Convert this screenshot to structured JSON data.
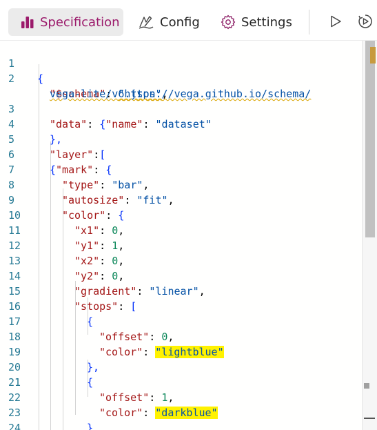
{
  "toolbar": {
    "tabs": [
      {
        "label": "Specification",
        "icon": "bar-chart-icon",
        "active": true
      },
      {
        "label": "Config",
        "icon": "pen-signature-icon"
      },
      {
        "label": "Settings",
        "icon": "gear-icon"
      }
    ],
    "run_icon": "play-icon",
    "autorun_icon": "auto-run-icon"
  },
  "colors": {
    "active_tab_accent": "#9b1a6b",
    "line_number": "#237893",
    "key": "#a31515",
    "string": "#0451a5",
    "number": "#098658",
    "highlight": "#fff200"
  },
  "editor": {
    "line_numbers": [
      "1",
      "2",
      "",
      "3",
      "4",
      "5",
      "6",
      "7",
      "8",
      "9",
      "10",
      "11",
      "12",
      "13",
      "14",
      "15",
      "16",
      "17",
      "18",
      "19",
      "20",
      "21",
      "22",
      "23",
      "24"
    ],
    "tokens": {
      "l1_open": "{",
      "schema_key": "\"$schema\"",
      "colon_space": ": ",
      "colon": ":",
      "schema_url_1": "\"https://vega.github.io/schema/",
      "schema_url_2": "vega-lite/v6.json\"",
      "comma": ",",
      "data_key": "\"data\"",
      "open_brace": "{",
      "name_key": "\"name\"",
      "dataset_val": "\"dataset\"",
      "close_brace_comma": "},",
      "layer_key": "\"layer\"",
      "open_bracket": "[",
      "mark_key": "\"mark\"",
      "type_key": "\"type\"",
      "bar_val": "\"bar\"",
      "autosize_key": "\"autosize\"",
      "fit_val": "\"fit\"",
      "color_key": "\"color\"",
      "x1_key": "\"x1\"",
      "y1_key": "\"y1\"",
      "x2_key": "\"x2\"",
      "y2_key": "\"y2\"",
      "zero": "0",
      "one": "1",
      "gradient_key": "\"gradient\"",
      "linear_val": "\"linear\"",
      "stops_key": "\"stops\"",
      "offset_key": "\"offset\"",
      "lightblue_val": "\"lightblue\"",
      "darkblue_val": "\"darkblue\"",
      "close_brace": "}",
      "close_bracket": "]"
    }
  }
}
